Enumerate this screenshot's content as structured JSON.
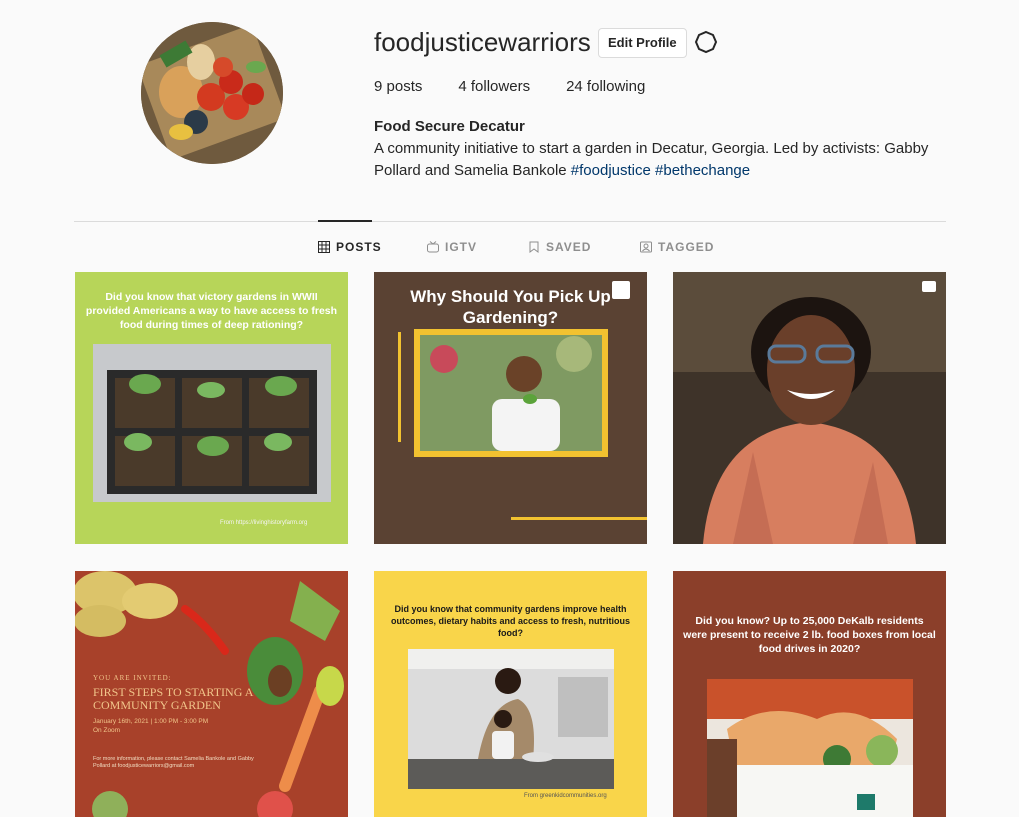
{
  "profile": {
    "username": "foodjusticewarriors",
    "edit_label": "Edit Profile",
    "settings_icon": "gear-icon",
    "stats": [
      {
        "label": "9 posts"
      },
      {
        "label": "4 followers"
      },
      {
        "label": "24 following"
      }
    ],
    "full_name": "Food Secure Decatur",
    "bio_text": "A community initiative to start a garden in Decatur, Georgia. Led by activists: Gabby Pollard and Samelia Bankole",
    "hashtags": [
      "#foodjustice",
      "#bethechange"
    ]
  },
  "tabs": [
    {
      "label": "POSTS",
      "icon": "grid-icon",
      "active": true
    },
    {
      "label": "IGTV",
      "icon": "tv-icon",
      "active": false
    },
    {
      "label": "SAVED",
      "icon": "bookmark-icon",
      "active": false
    },
    {
      "label": "TAGGED",
      "icon": "tag-person-icon",
      "active": false
    }
  ],
  "posts": [
    {
      "title": "Did you know that victory gardens in WWII provided Americans a way to have access to fresh food during times of deep rationing?",
      "credit": "From https://livinghistoryfarm.org",
      "color": "#b7d559"
    },
    {
      "title": "Why Should You Pick Up Gardening?",
      "badge_icon": "carousel-icon",
      "color": "#5a4233"
    },
    {
      "badge_icon": "video-camera-icon",
      "color": "#5b4c3b"
    },
    {
      "pretitle": "YOU ARE INVITED:",
      "title": "FIRST STEPS TO STARTING A COMMUNITY GARDEN",
      "date": "January 16th, 2021 | 1:00 PM - 3:00 PM",
      "location": "On Zoom",
      "info": "For more information, please contact Samelia Bankole and Gabby Pollard at foodjusticewarriors@gmail.com",
      "color": "#a8412a"
    },
    {
      "title": "Did you know that community gardens improve health outcomes, dietary habits and access to fresh, nutritious food?",
      "credit": "From greenkidcommunities.org",
      "color": "#f9d54a"
    },
    {
      "title": "Did you know? Up to 25,000 DeKalb residents were present to receive 2 lb. food boxes from local food drives in 2020?",
      "color": "#8b3f2a"
    }
  ]
}
